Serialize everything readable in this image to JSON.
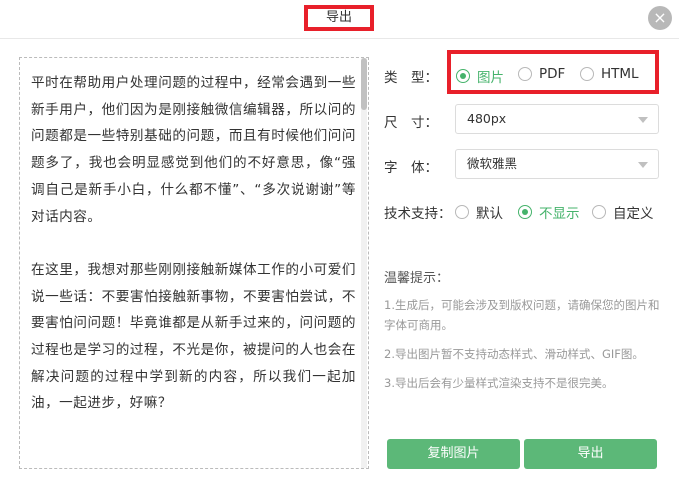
{
  "dialog": {
    "title": "导出",
    "close_symbol": "×"
  },
  "preview": {
    "paragraphs": [
      "平时在帮助用户处理问题的过程中，经常会遇到一些新手用户，他们因为是刚接触微信编辑器，所以问的问题都是一些特别基础的问题，而且有时候他们问问题多了，我也会明显感觉到他们的不好意思，像“强调自己是新手小白，什么都不懂”、“多次说谢谢”等对话内容。",
      "在这里，我想对那些刚刚接触新媒体工作的小可爱们说一些话：不要害怕接触新事物，不要害怕尝试，不要害怕问问题！毕竟谁都是从新手过来的，问问题的过程也是学习的过程，不光是你，被提问的人也会在解决问题的过程中学到新的内容，所以我们一起加油，一起进步，好嘛？"
    ]
  },
  "form": {
    "type_label": "类　型：",
    "type_options": [
      "图片",
      "PDF",
      "HTML"
    ],
    "type_selected": "图片",
    "size_label": "尺　寸：",
    "size_value": "480px",
    "font_label": "字　体：",
    "font_value": "微软雅黑",
    "support_label": "技术支持：",
    "support_options": [
      "默认",
      "不显示",
      "自定义"
    ],
    "support_selected": "不显示"
  },
  "tips": {
    "title": "温馨提示：",
    "items": [
      "1.生成后，可能会涉及到版权问题，请确保您的图片和字体可商用。",
      "2.导出图片暂不支持动态样式、滑动样式、GIF图。",
      "3.导出后会有少量样式渲染支持不是很完美。"
    ]
  },
  "buttons": {
    "copy_image": "复制图片",
    "export": "导出"
  },
  "colors": {
    "accent_green": "#45b36b",
    "button_green": "#5cb878",
    "highlight_red": "#e8202a"
  }
}
